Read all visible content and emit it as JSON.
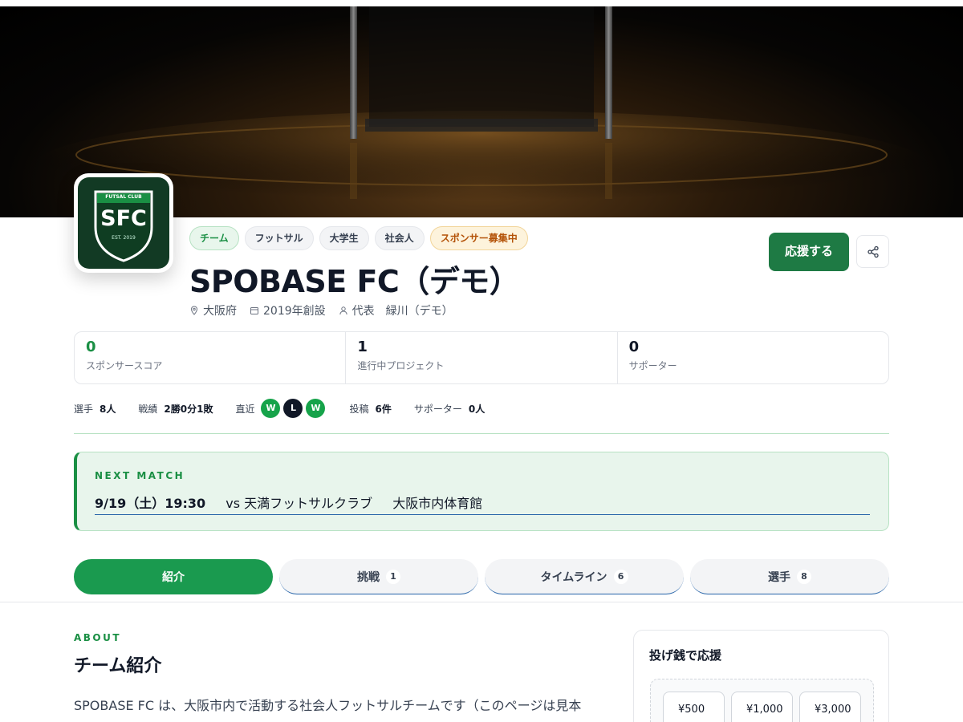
{
  "hero": {
    "description_icon": "futsal-goal-background"
  },
  "team": {
    "logo": {
      "top_text": "FUTSAL CLUB",
      "initials": "SFC",
      "est": "EST. 2019"
    },
    "tags": [
      {
        "label": "チーム",
        "style": "green"
      },
      {
        "label": "フットサル",
        "style": "gray"
      },
      {
        "label": "大学生",
        "style": "gray"
      },
      {
        "label": "社会人",
        "style": "gray"
      },
      {
        "label": "スポンサー募集中",
        "style": "amber"
      }
    ],
    "name": "SPOBASE FC（デモ）",
    "meta": {
      "location": "大阪府",
      "founded": "2019年創設",
      "representative": "代表　緑川（デモ）"
    }
  },
  "actions": {
    "support_label": "応援する",
    "share_icon": "share-icon"
  },
  "stats": [
    {
      "value": "0",
      "label": "スポンサースコア",
      "color": "#1a8f44"
    },
    {
      "value": "1",
      "label": "進行中プロジェクト"
    },
    {
      "value": "0",
      "label": "サポーター"
    }
  ],
  "quick": {
    "players_label": "選手",
    "players_value": "8人",
    "record_label": "戦績",
    "record_value": "2勝0分1敗",
    "recent_label": "直近",
    "recent": [
      "W",
      "L",
      "W"
    ],
    "posts_label": "投稿",
    "posts_value": "6件",
    "supporters_label": "サポーター",
    "supporters_value": "0人"
  },
  "next_match": {
    "label": "NEXT MATCH",
    "date": "9/19（土）19:30",
    "opponent": "vs 天満フットサルクラブ",
    "venue": "大阪市内体育館"
  },
  "tabs": [
    {
      "label": "紹介",
      "count": ""
    },
    {
      "label": "挑戦",
      "count": "1"
    },
    {
      "label": "タイムライン",
      "count": "6"
    },
    {
      "label": "選手",
      "count": "8"
    }
  ],
  "about": {
    "label": "ABOUT",
    "title": "チーム紹介",
    "text": "SPOBASE FC は、大阪市内で活動する社会人フットサルチームです（このページは見本"
  },
  "tip": {
    "title": "投げ銭で応援",
    "amounts": [
      "¥500",
      "¥1,000",
      "¥3,000"
    ]
  },
  "colors": {
    "brand": "#1a8f44",
    "button": "#1e7a44",
    "amber": "#b45309"
  }
}
